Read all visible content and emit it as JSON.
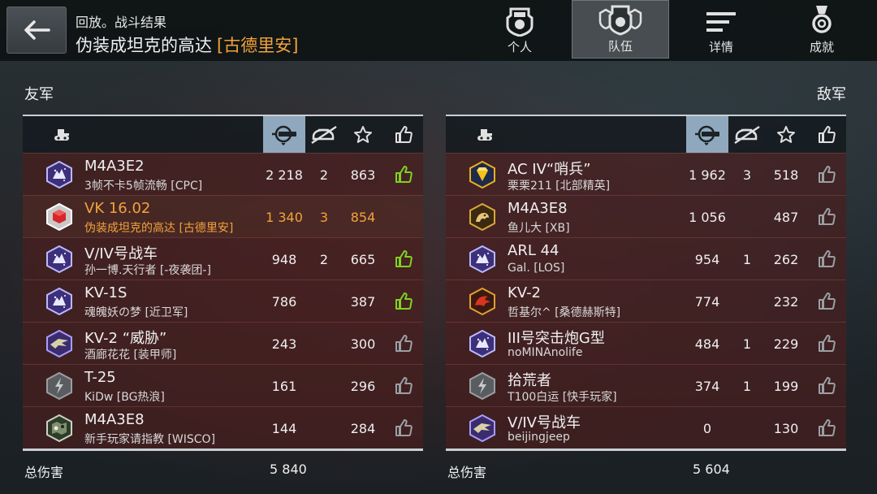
{
  "header": {
    "subtitle": "回放。战斗结果",
    "title": "伪装成坦克的高达",
    "clan": "[古德里安]"
  },
  "tabs": [
    {
      "label": "个人",
      "icon": "personal-badge-icon",
      "active": false
    },
    {
      "label": "队伍",
      "icon": "team-badge-icon",
      "active": true
    },
    {
      "label": "详情",
      "icon": "details-lines-icon",
      "active": false
    },
    {
      "label": "成就",
      "icon": "medal-icon",
      "active": false
    }
  ],
  "allies": {
    "label": "友军",
    "total_label": "总伤害",
    "total_value": "5 840",
    "rows": [
      {
        "tank": "M4A3E2",
        "player": "3帧不卡5帧流畅 [CPC]",
        "damage": "2 218",
        "kills": "2",
        "exp": "863",
        "like": "green",
        "emblem": "wolf-emblem",
        "me": false
      },
      {
        "tank": "VK 16.02",
        "player": "伪装成坦克的高达 [古德里安]",
        "damage": "1 340",
        "kills": "3",
        "exp": "854",
        "like": "none",
        "emblem": "red-cube-emblem",
        "me": true
      },
      {
        "tank": "V/IV号战车",
        "player": "孙一博.天行者 [-夜袭团-]",
        "damage": "948",
        "kills": "2",
        "exp": "665",
        "like": "green",
        "emblem": "wolf-emblem",
        "me": false
      },
      {
        "tank": "KV-1S",
        "player": "魂魄妖の梦 [近卫军]",
        "damage": "786",
        "kills": "",
        "exp": "387",
        "like": "green",
        "emblem": "wolf-emblem",
        "me": false
      },
      {
        "tank": "KV-2 “威胁”",
        "player": "酒廊花花 [装甲师]",
        "damage": "243",
        "kills": "",
        "exp": "300",
        "like": "grey",
        "emblem": "eagle-emblem",
        "me": false
      },
      {
        "tank": "T-25",
        "player": "KiDw [BG热浪]",
        "damage": "161",
        "kills": "",
        "exp": "296",
        "like": "grey",
        "emblem": "lightning-emblem",
        "me": false
      },
      {
        "tank": "M4A3E8",
        "player": "新手玩家请指教 [WISCO]",
        "damage": "144",
        "kills": "",
        "exp": "284",
        "like": "grey",
        "emblem": "camo-emblem",
        "me": false
      }
    ]
  },
  "enemies": {
    "label": "敌军",
    "total_label": "总伤害",
    "total_value": "5 604",
    "rows": [
      {
        "tank": "AC IV“哨兵”",
        "player": "栗栗211 [北部精英]",
        "damage": "1 962",
        "kills": "3",
        "exp": "518",
        "like": "grey",
        "emblem": "gold-gem-emblem",
        "me": false
      },
      {
        "tank": "M4A3E8",
        "player": "鱼儿大 [XB]",
        "damage": "1 056",
        "kills": "",
        "exp": "487",
        "like": "grey",
        "emblem": "gold-beast-emblem",
        "me": false
      },
      {
        "tank": "ARL 44",
        "player": "Gal. [LOS]",
        "damage": "954",
        "kills": "1",
        "exp": "262",
        "like": "grey",
        "emblem": "wolf-emblem",
        "me": false
      },
      {
        "tank": "KV-2",
        "player": "哲基尔^ [桑德赫斯特]",
        "damage": "774",
        "kills": "",
        "exp": "232",
        "like": "grey",
        "emblem": "red-dragon-emblem",
        "me": false
      },
      {
        "tank": "III号突击炮G型",
        "player": "noMINAnolife",
        "damage": "484",
        "kills": "1",
        "exp": "229",
        "like": "grey",
        "emblem": "wolf-emblem",
        "me": false
      },
      {
        "tank": "拾荒者",
        "player": "T100白运 [快手玩家]",
        "damage": "374",
        "kills": "1",
        "exp": "199",
        "like": "grey",
        "emblem": "lightning-emblem",
        "me": false
      },
      {
        "tank": "V/IV号战车",
        "player": "beijingjeep",
        "damage": "0",
        "kills": "",
        "exp": "130",
        "like": "grey",
        "emblem": "eagle-emblem",
        "me": false
      }
    ]
  },
  "columns": {
    "icons": [
      "tank-icon",
      "damage-icon",
      "kills-icon",
      "star-icon",
      "thumbs-up-icon"
    ],
    "sorted_by": "damage-icon"
  },
  "colors": {
    "accent": "#f2a33a",
    "like_green": "#7ed321",
    "like_grey": "#9aa0a4",
    "sort_highlight": "#8fa8bd"
  }
}
